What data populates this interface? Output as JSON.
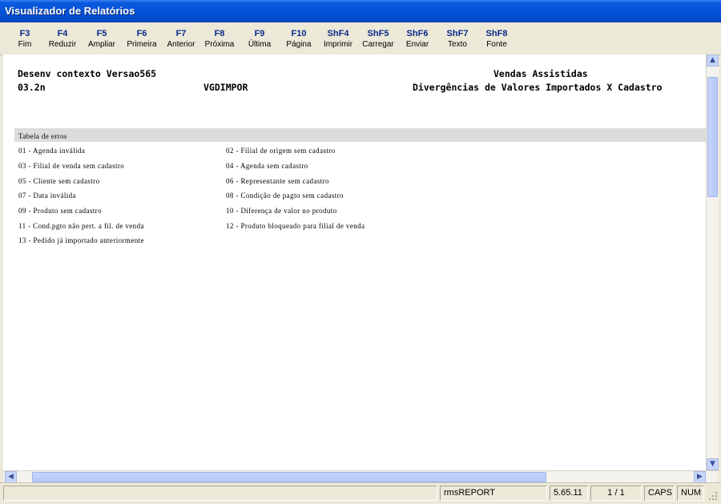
{
  "window": {
    "title": "Visualizador de Relatórios"
  },
  "toolbar": [
    {
      "key": "F3",
      "label": "Fim"
    },
    {
      "key": "F4",
      "label": "Reduzir"
    },
    {
      "key": "F5",
      "label": "Ampliar"
    },
    {
      "key": "F6",
      "label": "Primeira"
    },
    {
      "key": "F7",
      "label": "Anterior"
    },
    {
      "key": "F8",
      "label": "Próxima"
    },
    {
      "key": "F9",
      "label": "Última"
    },
    {
      "key": "F10",
      "label": "Página"
    },
    {
      "key": "ShF4",
      "label": "Imprimir"
    },
    {
      "key": "ShF5",
      "label": "Carregar"
    },
    {
      "key": "ShF6",
      "label": "Enviar"
    },
    {
      "key": "ShF7",
      "label": "Texto"
    },
    {
      "key": "ShF8",
      "label": "Fonte"
    }
  ],
  "report": {
    "header": {
      "context": "Desenv contexto Versao565",
      "version": "03.2n",
      "program": "VGDIMPOR",
      "system": "Vendas Assistidas",
      "title": "Divergências de Valores Importados X Cadastro"
    },
    "table_title": "Tabela de erros",
    "errors": [
      "01 - Agenda inválida",
      "02 - Filial de origem sem cadastro",
      "03 - Filial de venda sem cadastro",
      "04 - Agenda sem cadastro",
      "05 - Cliente sem cadastro",
      "06 - Representante sem cadastro",
      "07 - Data inválida",
      "08 - Condição de pagto sem cadastro",
      "09 - Produto sem cadastro",
      "10 - Diferença de valor no produto",
      "11 - Cond.pgto não pert. a fil. de venda",
      "12 - Produto bloqueado para filial de venda",
      "13 - Pedido já importado anteriormente"
    ]
  },
  "status": {
    "app": "rmsREPORT",
    "version": "5.65.11",
    "page": "1 / 1",
    "caps": "CAPS",
    "num": "NUM"
  },
  "icons": {
    "scroll_up": "arrow-up-icon",
    "scroll_down": "arrow-down-icon",
    "scroll_left": "arrow-left-icon",
    "scroll_right": "arrow-right-icon",
    "grip": "resize-grip-icon"
  }
}
